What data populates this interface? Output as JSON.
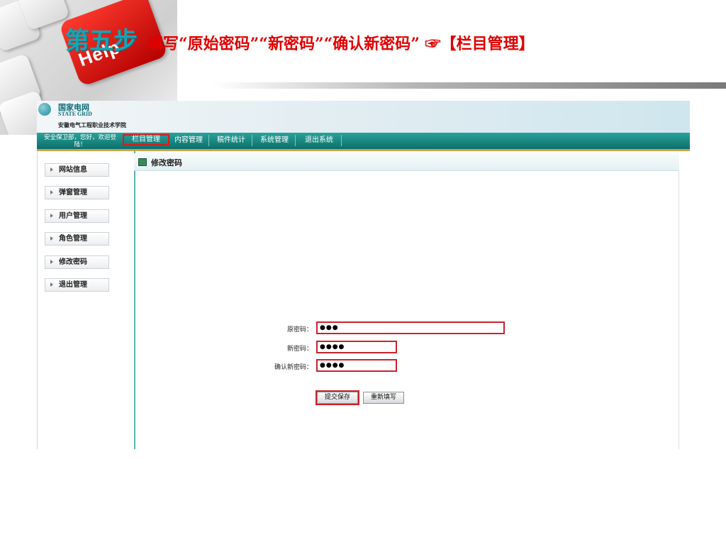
{
  "slide": {
    "help_key_label": "Help",
    "step_label": "第五步",
    "step_text": "填写“原始密码”“新密码”“确认新密码” ☞【栏目管理】"
  },
  "app": {
    "logo": {
      "cn": "国家电网",
      "en": "STATE GRID",
      "school": "安徽电气工程职业技术学院"
    },
    "welcome": "安全保卫部，您好，欢迎登陆！",
    "nav": [
      "栏目管理",
      "内容管理",
      "稿件统计",
      "系统管理",
      "退出系统"
    ],
    "active_nav": 0,
    "sidebar": [
      "网站信息",
      "弹窗管理",
      "用户管理",
      "角色管理",
      "修改密码",
      "退出管理"
    ],
    "panel_title": "修改密码",
    "form": {
      "old_label": "原密码：",
      "old_value": "●●●",
      "new_label": "新密码：",
      "new_value": "●●●●",
      "confirm_label": "确认新密码：",
      "confirm_value": "●●●●",
      "submit_label": "提交保存",
      "reset_label": "重新填写"
    }
  },
  "colors": {
    "title_teal": "#1aa3b3",
    "title_red": "#e10000",
    "nav_teal": "#0d6f6a",
    "highlight_red": "#c9242c"
  },
  "icons": [
    "keyboard-help-key",
    "state-grid-globe-icon",
    "arrow-right-icon",
    "edit-page-icon"
  ]
}
